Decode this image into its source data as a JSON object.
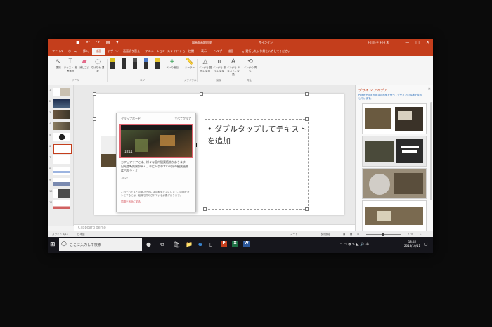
{
  "titlebar": {
    "doc_title": "図画面画地前理",
    "sign_in": "サインイン",
    "account": "石川氏テ 石田 木",
    "qat_icons": [
      "save-icon",
      "undo-icon",
      "redo-icon",
      "slideshow-icon",
      "customize-icon"
    ],
    "qat_glyphs": [
      "▣",
      "↶",
      "↷",
      "▤",
      "▾"
    ],
    "win_glyphs": [
      "—",
      "▢",
      "✕"
    ]
  },
  "ribbon_tabs": [
    "ファイル",
    "ホーム",
    "挿入",
    "描画",
    "デザイン",
    "画面切り替え",
    "アニメーション",
    "スライド ショー",
    "校閲",
    "表示",
    "ヘルプ",
    "描画"
  ],
  "active_tab_index": 3,
  "tell_me": "実行したい作業を入力してください",
  "ribbon": {
    "tools": [
      "選択",
      "テキスト\n範囲選択",
      "消しゴム",
      "なげなわ\n選択"
    ],
    "pens": [
      "#d8c020",
      "#303030",
      "#505050",
      "#4a78c8",
      "#e8c830"
    ],
    "add_pen": "ペンの追加",
    "ruler": "ルーラー",
    "ink_to_shape": "インクを\n図形に変換",
    "ink_to_math": "インクを\n数式に変換",
    "ink_to_text": "インクを\nテキストに変換",
    "ink_replay": "インクの\n再生",
    "groups": [
      "ツール",
      "ペン",
      "ステンシル",
      "変換",
      "再生"
    ]
  },
  "slides": [
    {
      "num": "1"
    },
    {
      "num": "2"
    },
    {
      "num": "3"
    },
    {
      "num": "4"
    },
    {
      "num": "5"
    },
    {
      "num": "6"
    },
    {
      "num": "7"
    },
    {
      "num": "8"
    },
    {
      "num": "9"
    },
    {
      "num": "10"
    },
    {
      "num": "11"
    }
  ],
  "active_slide_index": 5,
  "textbox_text": "ダブルタップしてテキストを追加",
  "clipboard": {
    "title": "クリップボード",
    "more": "すべてクリア",
    "time": "18:11",
    "body": "カフェアリアには、様々な室内観葉植物があります。日光遮断効果が高く、手に入りやすい人気の観葉植物はパキラ・ミ",
    "body_time": "18:27",
    "note": "このデバイスと同期させるには同期をオンにします。同期をオンにするには、組織で許可されている必要があります。",
    "link": "同期を有効にする"
  },
  "notes_placeholder": "Clipboard demo",
  "design_pane": {
    "title": "デザイン アイデア",
    "note": "PowerPoint が既定の画像を使ってデザインの候補を表示しています。"
  },
  "status": {
    "slide_info": "スライド 6/11",
    "language": "日本語",
    "notes": "ノート",
    "display": "表示設定",
    "zoom": "77%"
  },
  "taskbar": {
    "search": "ここに入力して検索",
    "time": "18:42",
    "date": "2018/10/11",
    "icons": [
      "microphone-icon",
      "task-view-icon",
      "store-icon",
      "file-explorer-icon",
      "edge-icon",
      "tablet-icon",
      "powerpoint-icon",
      "excel-icon",
      "word-icon"
    ],
    "glyphs": [
      "●",
      "⧉",
      "🛍",
      "📁",
      "e",
      "▯"
    ]
  }
}
